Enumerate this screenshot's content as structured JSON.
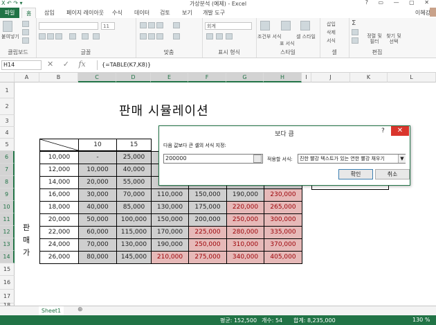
{
  "window": {
    "title": "가상분석 (예제) - Excel",
    "qat": "X  ↶ ↷ ▾",
    "controls": "?  ▭  —  ▢  ✕"
  },
  "tabs": [
    "파일",
    "홈",
    "삽입",
    "페이지 레이아웃",
    "수식",
    "데이터",
    "검토",
    "보기",
    "개발 도구"
  ],
  "user": "이혜강",
  "ribbon": {
    "groups": [
      "클립보드",
      "글꼴",
      "맞춤",
      "표시 형식",
      "스타일",
      "셀",
      "편집"
    ],
    "paste_label": "붙여넣기",
    "font_size": "11",
    "number_format": "회계",
    "style_items": [
      "조건부 서식",
      "표 서식",
      "셀 스타일"
    ],
    "cell_items": [
      "삽입",
      "삭제",
      "서식"
    ],
    "edit_items": [
      "정렬 및 필터",
      "찾기 및 선택"
    ]
  },
  "formula_bar": {
    "name_box": "H14",
    "cancel": "✕",
    "enter": "✓",
    "fx": "fx",
    "formula": "{=TABLE(K7,K8)}"
  },
  "columns": [
    "A",
    "B",
    "C",
    "D",
    "E",
    "F",
    "G",
    "H",
    "I",
    "J",
    "K",
    "L"
  ],
  "rows": [
    "1",
    "2",
    "3",
    "4",
    "5",
    "6",
    "7",
    "8",
    "9",
    "10",
    "11",
    "12",
    "13",
    "14",
    "15",
    "16",
    "17",
    "18"
  ],
  "sheet": {
    "title": "판매 시뮬레이션",
    "side_label": [
      "판",
      "매",
      "가"
    ],
    "header_row": [
      "10",
      "15"
    ],
    "table": [
      [
        "10,000",
        "-",
        "25,000",
        "",
        "",
        "",
        ""
      ],
      [
        "12,000",
        "10,000",
        "40,000",
        "",
        "",
        "",
        ""
      ],
      [
        "14,000",
        "20,000",
        "55,000",
        "",
        "",
        "",
        ""
      ],
      [
        "16,000",
        "30,000",
        "70,000",
        "110,000",
        "150,000",
        "190,000",
        "230,000"
      ],
      [
        "18,000",
        "40,000",
        "85,000",
        "130,000",
        "175,000",
        "220,000",
        "265,000"
      ],
      [
        "20,000",
        "50,000",
        "100,000",
        "150,000",
        "200,000",
        "250,000",
        "300,000"
      ],
      [
        "22,000",
        "60,000",
        "115,000",
        "170,000",
        "225,000",
        "280,000",
        "335,000"
      ],
      [
        "24,000",
        "70,000",
        "130,000",
        "190,000",
        "250,000",
        "310,000",
        "370,000"
      ],
      [
        "26,000",
        "80,000",
        "145,000",
        "210,000",
        "275,000",
        "340,000",
        "405,000"
      ]
    ]
  },
  "dialog": {
    "title": "보다 큼",
    "help": "?",
    "close": "✕",
    "prompt": "다음 값보다 큰 셀의 서식 지정:",
    "value": "200000",
    "format_label": "적용할 서식:",
    "format_value": "진한 빨강 텍스트가 있는 연한 빨강 채우기",
    "ok": "확인",
    "cancel": "취소"
  },
  "sheet_tab": "Sheet1",
  "add_sheet": "⊕",
  "status": {
    "average": "평균: 152,500",
    "count": "개수: 54",
    "sum": "합계: 8,235,000",
    "zoom": "130 %"
  },
  "colors": {
    "accent": "#217346",
    "highlight_fill": "#e6b9b8",
    "highlight_text": "#9c0006"
  }
}
